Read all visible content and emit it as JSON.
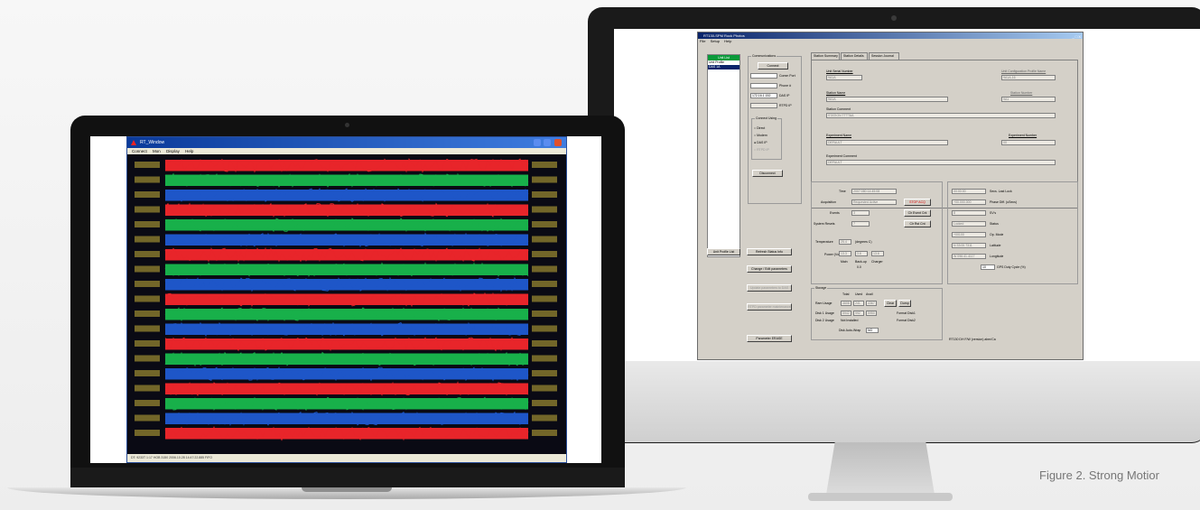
{
  "caption": "Figure 2. Strong Motior",
  "rockhound": {
    "title": "RT130-SPM Rock Photos",
    "window_controls": "_ □ X",
    "menu": [
      "File",
      "Setup",
      "Help"
    ],
    "tree": {
      "root": "Unit List",
      "items": [
        "Unit Profile",
        "DAS 1A"
      ]
    },
    "communications": {
      "caption": "Communications",
      "connect": "Connect",
      "comm_port_label": "Comm Port",
      "phone_label": "Phone #",
      "das_ip_value": "172.16.1.152",
      "das_ip_label": "DAS IP",
      "rtpd_ip_label": "RTPD IP",
      "connect_using": "Connect Using",
      "options": [
        "Direct",
        "Modem",
        "DAS IP",
        "RTPD IP"
      ],
      "disconnect": "Disconnect"
    },
    "left_buttons": {
      "unit_profile_list": "Unit Profile List",
      "refresh": "Refresh Status Info",
      "change_edit": "Change / Edit parameters",
      "update": "Update parameters to DAS",
      "rtpd": "RTPD parameter maintenance",
      "erase": "Parameter ERASE"
    },
    "tabs": [
      "Station Summary",
      "Station Details",
      "Session Journal"
    ],
    "summary": {
      "unit_serial_label": "Unit Serial Number",
      "unit_serial": "9A1A",
      "unit_config_label": "Unit Configuration Profile Name",
      "unit_config": "9A1A-16",
      "station_name_label": "Station Name",
      "station_name": "9A1A",
      "station_number_label": "Station Number",
      "station_number": "9A1",
      "station_comment_label": "Station Comment",
      "station_comment": "STATION TTTTAA",
      "experiment_name_label": "Experiment Name",
      "experiment_name": "DEFAULT",
      "experiment_number_label": "Experiment Number",
      "experiment_number": "00",
      "experiment_comment_label": "Experiment Comment",
      "experiment_comment": "DEFAULT"
    },
    "status": {
      "time_label": "Time",
      "time": "2007:080:14:45:08",
      "acq_label": "Acquisition",
      "acq": "Requested Active",
      "stop_acq": "STOP ACQ",
      "events_label": "Events",
      "events": "3",
      "clr_event": "Clr Event Cnt",
      "sys_resets_label": "System Resets",
      "sys_resets": "7",
      "clr_rst": "Clr Rst Cnt",
      "temp_label": "Temperature",
      "temp": "25.4",
      "temp_unit": "(degrees C)",
      "power_label": "Power (Volts)",
      "main_v": "13.3",
      "backup_v": "3.6",
      "charger_v": "13.6",
      "main_label": "Main",
      "backup_label": "Back-up",
      "backup_v2": "0.0",
      "charger_label": "Charger"
    },
    "gps": {
      "since_last_lock": "00:00:00",
      "since_label": "Secs. Last Lock",
      "phase": "+00.000.000",
      "phase_label": "Phase Diff. (uSecs)",
      "svs": "8",
      "svs_label": "SV's",
      "status": "Locked",
      "status_label": "Status",
      "mode": "+00100",
      "mode_label": "Op. Mode",
      "lat": "N 33:00.7311",
      "lat_label": "Latitude",
      "lon": "W 096:41.4117",
      "lon_label": "Longitude",
      "duty": "10",
      "duty_label": "GPS Duty Cycle (%)"
    },
    "storage": {
      "caption": "Storage",
      "headers": [
        "Total",
        "Used",
        "Avail"
      ],
      "ram_label": "Ram Usage",
      "ram": [
        "4608",
        "241",
        "4367"
      ],
      "clear": "Clear",
      "dump": "Dump",
      "disk1_label": "Disk 1 Usage",
      "disk1": [
        "5942",
        "992",
        "5950"
      ],
      "format1": "Format Disk1",
      "disk2_label": "Disk 2 Usage",
      "disk2": "Not Installed",
      "format2": "Format Disk2",
      "autowrap_label": "Disk Auto-Wrap",
      "autowrap": "NO"
    },
    "footer": "RT130 DH   F/W (version)   abm/Ca"
  },
  "rtwave": {
    "title": "RT_Window",
    "menu": [
      "Connect",
      "Mon",
      "Display",
      "Help"
    ],
    "status": "DT: 9233T 1:17 HOB 3150 2006.10.28 14:47:22.885 FIFO",
    "band_colors": [
      "#e8252a",
      "#18b04a",
      "#1e56c8"
    ]
  }
}
